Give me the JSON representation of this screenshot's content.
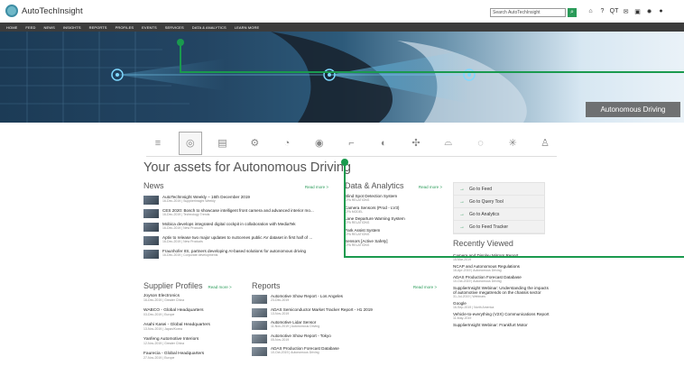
{
  "header": {
    "logo_text": "AutoTechInsight",
    "search_placeholder": "Search AutoTechInsight",
    "icons": [
      "home-icon",
      "help-icon",
      "qt-icon",
      "mail-icon",
      "image-icon",
      "gear-icon",
      "user-icon"
    ],
    "qt_label": "QT"
  },
  "nav": {
    "items": [
      "HOME",
      "FEED",
      "NEWS",
      "INSIGHTS",
      "REPORTS",
      "PROFILES",
      "EVENTS",
      "SERVICES",
      "DATA & ANALYTICS",
      "LEARN MORE"
    ]
  },
  "banner": {
    "caption": "Autonomous Driving"
  },
  "categories": [
    "menu-icon",
    "steering-icon",
    "battery-icon",
    "engine-icon",
    "gauge-icon",
    "brake-icon",
    "seat-icon",
    "headlight-icon",
    "sensor-network-icon",
    "car-icon",
    "chassis-icon",
    "wheel-icon",
    "person-icon"
  ],
  "assets_title": "Your assets for Autonomous Driving",
  "news": {
    "title": "News",
    "read_more": "Read more >",
    "items": [
      {
        "title": "AutoTechInsight Weekly – 16th December 2019",
        "meta": "16-Dec-2019 | SupplierInsight Weekly"
      },
      {
        "title": "CES 2020: Bosch to showcase intelligent front camera and advanced interior mo...",
        "meta": "16-Dec-2019 | Technology Trends"
      },
      {
        "title": "Mobica develops integrated digital cockpit in collaboration with MediaTek",
        "meta": "16-Dec-2019 | New Products"
      },
      {
        "title": "Aptiv to release two major updates to nuScenes public AV dataset in first half of ...",
        "meta": "16-Dec-2019 | New Products"
      },
      {
        "title": "Fraunhofer IIS, partners developing AI-based solutions for autonomous driving",
        "meta": "16-Dec-2019 | Corporate developments"
      }
    ]
  },
  "data_analytics": {
    "title": "Data & Analytics",
    "read_more": "Read more >",
    "items": [
      {
        "title": "Blind Spot Detection System",
        "meta": "CPA RELATIONS"
      },
      {
        "title": "Camera Sensors (Prod - LV3)",
        "meta": "CPA MODEL"
      },
      {
        "title": "Lane Departure Warning System",
        "meta": "CPA RELATIONS"
      },
      {
        "title": "Park Assist System",
        "meta": "CPA RELATIONS"
      },
      {
        "title": "Sensors [Active Safety]",
        "meta": "CPA RELATIONS"
      }
    ]
  },
  "goto": [
    "Go to Feed",
    "Go to Query Tool",
    "Go to Analytics",
    "Go to Feed Tracker"
  ],
  "recently_viewed": {
    "title": "Recently Viewed",
    "items": [
      {
        "title": "Camera and Display Mirrors Report",
        "meta": "15-Mar-2019"
      },
      {
        "title": "NCAP and Autonomous Regulations",
        "meta": "16-Apr-2019 | Autonomous Driving"
      },
      {
        "title": "ADAS Production Forecast Database",
        "meta": "10-Oct-2019 | Autonomous Driving"
      },
      {
        "title": "SupplierInsight Webinar: Understanding the impacts of automotive megatrends on the chassis sector",
        "meta": "31-Jul-2019 | Webinars"
      },
      {
        "title": "Google",
        "meta": "16-Sep-2019 | North America"
      },
      {
        "title": "Vehicle-to-everything (V2X) Communications Report",
        "meta": "11-May-2019"
      },
      {
        "title": "SupplierInsight Webinar: Frankfurt Motor",
        "meta": ""
      }
    ]
  },
  "supplier_profiles": {
    "title": "Supplier Profiles",
    "read_more": "Read more >",
    "items": [
      {
        "title": "Joyson Electronics",
        "meta": "16-Dec-2019 | Greater China"
      },
      {
        "title": "WABCO - Global Headquarters",
        "meta": "03-Dec-2019 | Europe"
      },
      {
        "title": "Asahi Kasei - Global Headquarters",
        "meta": "13-Nov-2019 | Japan/Korea"
      },
      {
        "title": "Yanfeng Automotive Interiors",
        "meta": "12-Nov-2019 | Greater China"
      },
      {
        "title": "Faurecia - Global Headquarters",
        "meta": "27-Nov-2019 | Europe"
      }
    ]
  },
  "reports": {
    "title": "Reports",
    "read_more": "Read more >",
    "items": [
      {
        "title": "Automotive Show Report - Los Angeles",
        "meta": "23-Dec-2019"
      },
      {
        "title": "ADAS Semiconductor Market Tracker Report - H1 2019",
        "meta": "13-Nov-2019"
      },
      {
        "title": "Automotive Lidar Sensor",
        "meta": "11-Nov-2019 | Autonomous Driving"
      },
      {
        "title": "Automotive Show Report - Tokyo",
        "meta": "05-Nov-2019"
      },
      {
        "title": "ADAS Production Forecast Database",
        "meta": "10-Oct-2019 | Autonomous Driving"
      }
    ]
  },
  "colors": {
    "accent_green": "#2a9b59",
    "nav_dark": "#3c3c3c"
  }
}
